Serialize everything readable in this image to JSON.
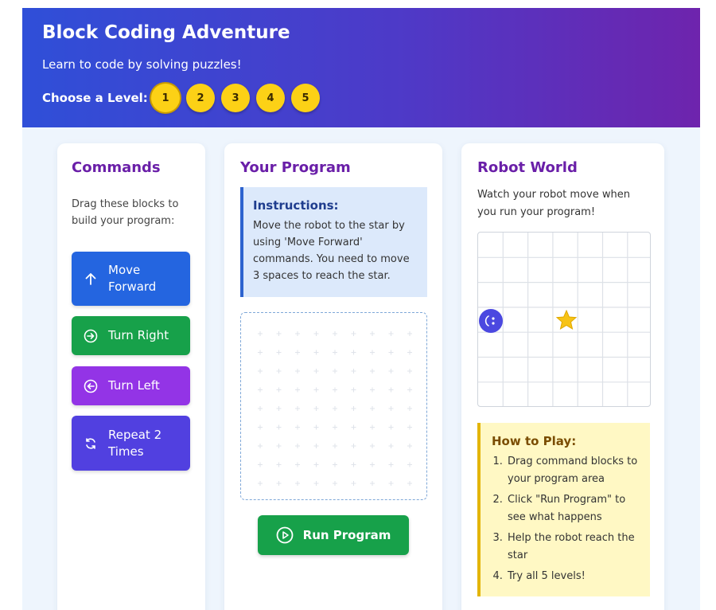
{
  "header": {
    "title": "Block Coding Adventure",
    "subtitle": "Learn to code by solving puzzles!",
    "level_label": "Choose a Level:",
    "levels": [
      "1",
      "2",
      "3",
      "4",
      "5"
    ],
    "active_level": "1"
  },
  "commands": {
    "title": "Commands",
    "description": "Drag these blocks to build your program:",
    "blocks": [
      {
        "label": "Move Forward",
        "icon": "arrow-up-icon",
        "color": "#2465e0"
      },
      {
        "label": "Turn Right",
        "icon": "arrow-right-circle-icon",
        "color": "#17a14a"
      },
      {
        "label": "Turn Left",
        "icon": "arrow-left-circle-icon",
        "color": "#9334e6"
      },
      {
        "label": "Repeat 2 Times",
        "icon": "repeat-icon",
        "color": "#5140e0"
      }
    ]
  },
  "program": {
    "title": "Your Program",
    "instructions_title": "Instructions:",
    "instructions_text": "Move the robot to the star by using 'Move Forward' commands. You need to move 3 spaces to reach the star.",
    "run_label": "Run Program"
  },
  "world": {
    "title": "Robot World",
    "description": "Watch your robot move when you run your program!",
    "grid": {
      "cols": 7,
      "rows": 7,
      "robot": {
        "col": 0,
        "row": 3
      },
      "star": {
        "col": 3,
        "row": 3
      }
    },
    "howto_title": "How to Play:",
    "howto_steps": [
      "Drag command blocks to your program area",
      "Click \"Run Program\" to see what happens",
      "Help the robot reach the star",
      "Try all 5 levels!"
    ]
  },
  "colors": {
    "header_start": "#2f4fd8",
    "header_end": "#6e24ad",
    "title_purple": "#6a1fa8",
    "level_yellow": "#fcd116",
    "run_green": "#17a14a"
  }
}
